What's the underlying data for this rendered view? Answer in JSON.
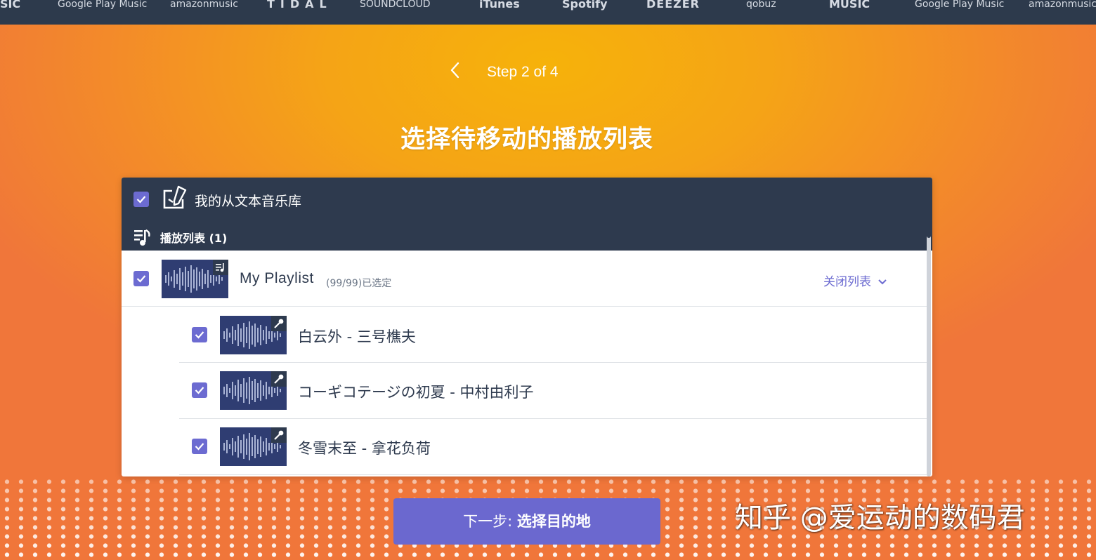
{
  "brands": [
    {
      "label": "JSIC",
      "weight": "bold"
    },
    {
      "label": "Google Play Music",
      "weight": "light"
    },
    {
      "label": "amazonmusic",
      "weight": "light"
    },
    {
      "label": "TIDAL",
      "weight": "bold"
    },
    {
      "label": "SOUNDCLOUD",
      "weight": "light"
    },
    {
      "label": "iTunes",
      "weight": "bold"
    },
    {
      "label": "Spotify",
      "weight": "bold"
    },
    {
      "label": "DEEZER",
      "weight": "bold"
    },
    {
      "label": "qobuz",
      "weight": "light"
    },
    {
      "label": "MUSIC",
      "weight": "bold"
    },
    {
      "label": "Google Play Music",
      "weight": "light"
    },
    {
      "label": "amazonmusic",
      "weight": "light"
    }
  ],
  "step": {
    "label": "Step 2 of 4"
  },
  "page_title": "选择待移动的播放列表",
  "library": {
    "title": "我的从文本音乐库",
    "checked": true,
    "section_label": "播放列表 (1)"
  },
  "playlist": {
    "name": "My Playlist",
    "count": "(99/99)已选定",
    "collapse_label": "关闭列表",
    "checked": true
  },
  "tracks": [
    {
      "title": "白云外 - 三号樵夫",
      "checked": true
    },
    {
      "title": "コーギコテージの初夏 - 中村由利子",
      "checked": true
    },
    {
      "title": "冬雪末至 - 拿花负荷",
      "checked": true
    }
  ],
  "next_button": {
    "prefix": "下一步: ",
    "label": "选择目的地"
  },
  "watermark": "知乎 @爱运动的数码君",
  "colors": {
    "accent": "#6c6bd1",
    "header_dark": "#2e3a4e",
    "bg_top": "#f6b20a",
    "bg_bottom": "#f0763a"
  }
}
